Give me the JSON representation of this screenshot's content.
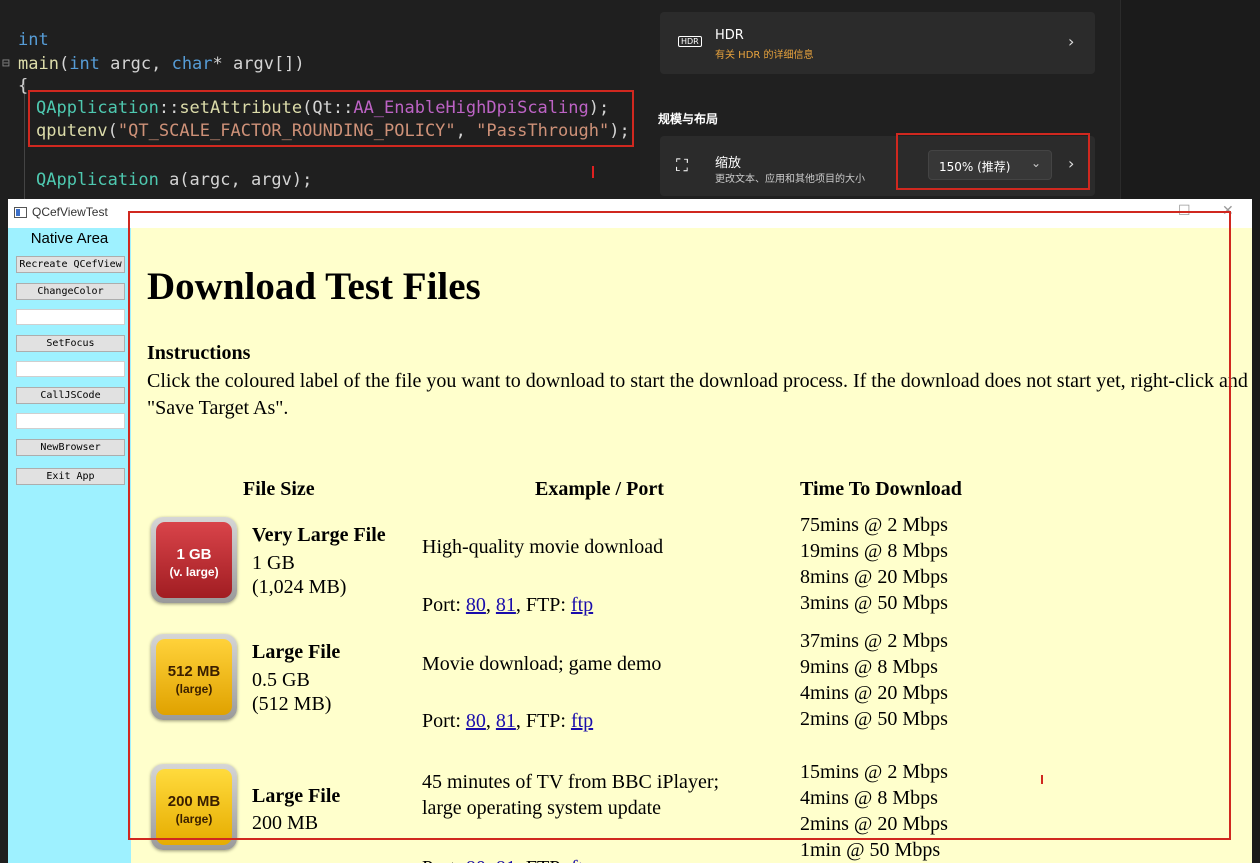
{
  "editor": {
    "lines": {
      "l1": "int",
      "l2_kw": "main",
      "l2_rest_a": "(",
      "l2_int": "int",
      "l2_b": " argc, ",
      "l2_char": "char",
      "l2_c": "* argv[])",
      "l3": "{",
      "l4_cls": "QApplication",
      "l4_a": "::",
      "l4_fn": "setAttribute",
      "l4_b": "(Qt::",
      "l4_c": "AA_EnableHighDpiScaling",
      "l4_d": ");",
      "l5_fn": "qputenv",
      "l5_a": "(",
      "l5_s1": "\"QT_SCALE_FACTOR_ROUNDING_POLICY\"",
      "l5_b": ", ",
      "l5_s2": "\"PassThrough\"",
      "l5_c": ");",
      "l6_cls": "QApplication",
      "l6_rest": " a(argc, argv);"
    }
  },
  "settings": {
    "hdr_icon": "HDR",
    "hdr_title": "HDR",
    "hdr_sub": "有关 HDR 的详细信息",
    "section": "规模与布局",
    "scale_title": "缩放",
    "scale_sub": "更改文本、应用和其他项目的大小",
    "scale_value": "150% (推荐)",
    "chevron": "›",
    "dropdown": "⌄",
    "scale_icon": "⛶"
  },
  "window": {
    "title": "QCefViewTest",
    "maximize": "☐",
    "close": "✕"
  },
  "native": {
    "label": "Native Area",
    "buttons": {
      "recreate": "Recreate QCefView",
      "change_color": "ChangeColor",
      "set_focus": "SetFocus",
      "call_js": "CallJSCode",
      "new_browser": "NewBrowser",
      "exit": "Exit App"
    }
  },
  "web": {
    "heading": "Download Test Files",
    "instructions_title": "Instructions",
    "instructions_text": "Click the coloured label of the file you want to download to start the download process. If the download does not start yet, right-click and select \"Save Target As\".",
    "columns": {
      "size": "File Size",
      "example": "Example / Port",
      "time": "Time To Download"
    },
    "port_label": "Port:",
    "ftp_label": ", FTP:",
    "link_80": "80",
    "link_81": "81",
    "link_ftp": "ftp",
    "comma": ",",
    "rows": [
      {
        "badge_main": "1 GB",
        "badge_sub": "(v. large)",
        "badge_color": "#b3262b",
        "badge_text_color": "#ffffff",
        "name": "Very Large File",
        "size1": "1 GB",
        "size2": "(1,024 MB)",
        "desc": "High-quality movie download",
        "times": [
          "75mins @ 2 Mbps",
          "19mins @ 8 Mbps",
          "8mins @ 20 Mbps",
          "3mins @ 50 Mbps"
        ]
      },
      {
        "badge_main": "512 MB",
        "badge_sub": "(large)",
        "badge_color": "#f2b705",
        "badge_text_color": "#3a1f00",
        "name": "Large File",
        "size1": "0.5 GB",
        "size2": "(512 MB)",
        "desc": "Movie download; game demo",
        "times": [
          "37mins @ 2 Mbps",
          "9mins @ 8 Mbps",
          "4mins @ 20 Mbps",
          "2mins @ 50 Mbps"
        ]
      },
      {
        "badge_main": "200 MB",
        "badge_sub": "(large)",
        "badge_color": "#f2c40a",
        "badge_text_color": "#3a1f00",
        "name": "Large File",
        "size1": "200 MB",
        "desc1": "45 minutes of TV from BBC iPlayer;",
        "desc2": "large operating system update",
        "times": [
          "15mins @ 2 Mbps",
          "4mins @ 8 Mbps",
          "2mins @ 20 Mbps",
          "1min @ 50 Mbps"
        ]
      }
    ]
  },
  "colors": {
    "highlight": "#d0281f",
    "native_bg": "#9ef1ff",
    "web_bg": "#ffffcc",
    "hdr_link": "#e8a33d"
  }
}
